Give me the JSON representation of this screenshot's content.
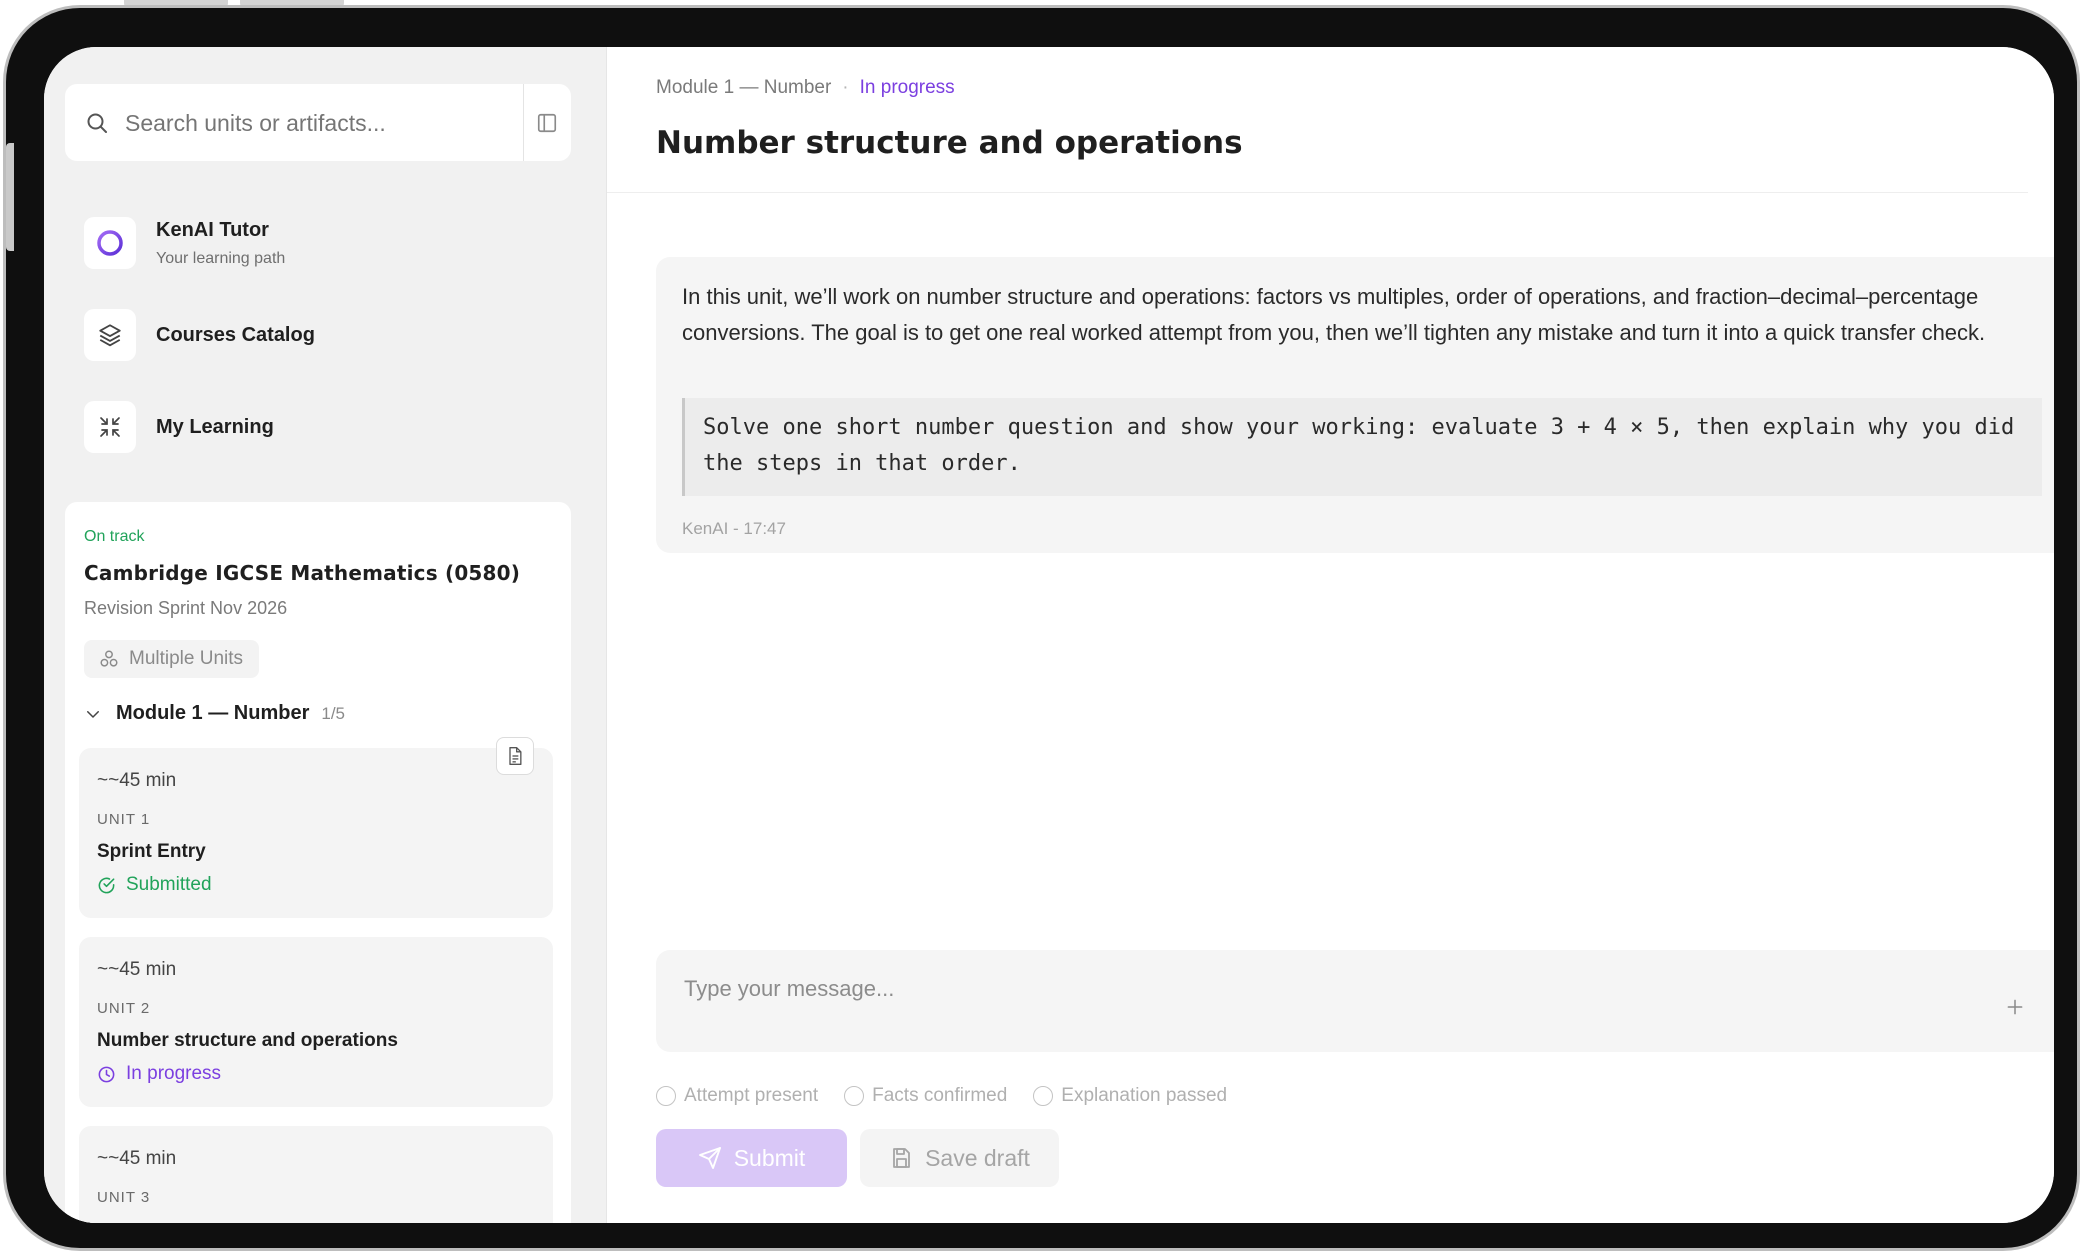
{
  "search": {
    "placeholder": "Search units or artifacts..."
  },
  "nav": [
    {
      "title": "KenAI Tutor",
      "subtitle": "Your learning path",
      "icon": "ring-logo-icon"
    },
    {
      "title": "Courses Catalog",
      "icon": "layers-icon"
    },
    {
      "title": "My Learning",
      "icon": "collapse-arrows-icon"
    }
  ],
  "course": {
    "status": "On track",
    "title": "Cambridge IGCSE Mathematics (0580)",
    "subtitle": "Revision Sprint Nov 2026",
    "units_chip": "Multiple Units",
    "module": {
      "label": "Module 1 — Number",
      "count": "1/5"
    },
    "units": [
      {
        "duration": "~~45 min",
        "label": "UNIT 1",
        "title": "Sprint Entry",
        "status": "Submitted",
        "status_color": "#21a35a"
      },
      {
        "duration": "~~45 min",
        "label": "UNIT 2",
        "title": "Number structure and operations",
        "status": "In progress",
        "status_color": "#7b3fe0"
      },
      {
        "duration": "~~45 min",
        "label": "UNIT 3",
        "title": "",
        "status": ""
      }
    ]
  },
  "main": {
    "breadcrumb": {
      "module": "Module 1 — Number",
      "separator": "·",
      "status": "In progress"
    },
    "title": "Number structure and operations",
    "message": {
      "text": "In this unit, we’ll work on number structure and operations: factors vs multiples, order of operations, and fraction–decimal–percentage conversions. The goal is to get one real worked attempt from you, then we’ll tighten any mistake and turn it into a quick transfer check.",
      "prompt": "Solve one short number question and show your working: evaluate 3 + 4 × 5, then explain why you did the steps in that order.",
      "meta": "KenAI - 17:47"
    },
    "composer": {
      "placeholder": "Type your message..."
    },
    "checks": [
      "Attempt present",
      "Facts confirmed",
      "Explanation passed"
    ],
    "submit_label": "Submit",
    "draft_label": "Save draft"
  },
  "colors": {
    "accent": "#7b3fe0",
    "success": "#21a35a",
    "submit_disabled": "#d9c7f7"
  }
}
